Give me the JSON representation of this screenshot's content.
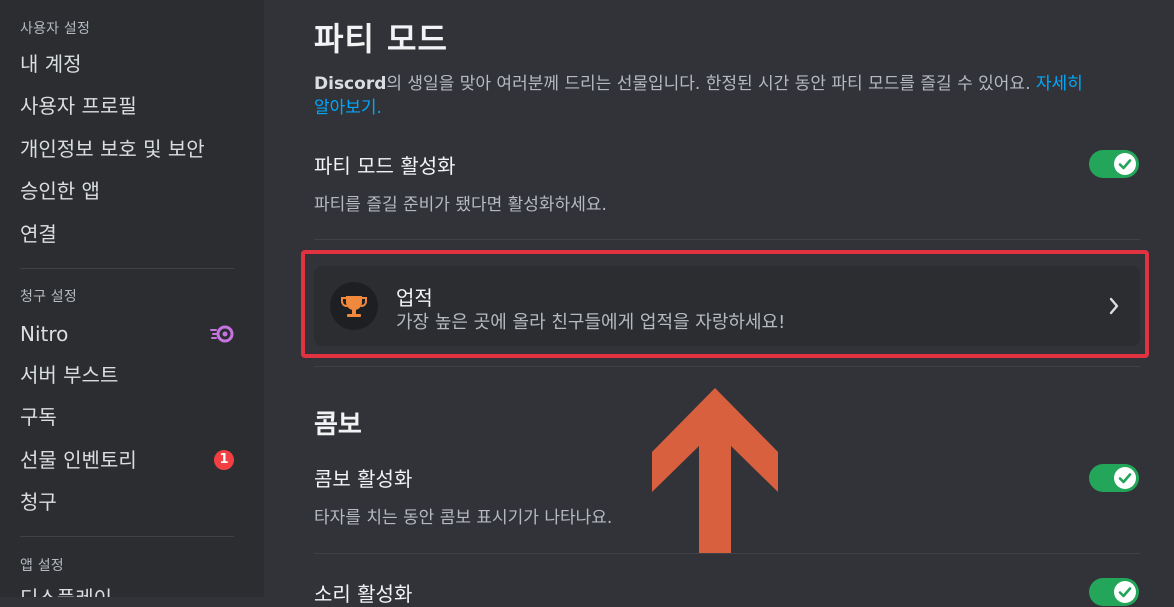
{
  "sidebar": {
    "user_settings_header": "사용자 설정",
    "user_items": [
      "내 계정",
      "사용자 프로필",
      "개인정보 보호 및 보안",
      "승인한 앱",
      "연결"
    ],
    "billing_header": "청구 설정",
    "billing_items": [
      "Nitro",
      "서버 부스트",
      "구독",
      "선물 인벤토리",
      "청구"
    ],
    "gift_badge": "1",
    "app_header": "앱 설정",
    "app_items_partial": "디스플레이"
  },
  "main": {
    "title": "파티 모드",
    "description_brand": "Discord",
    "description_text": "의 생일을 맞아 여러분께 드리는 선물입니다. 한정된 시간 동안 파티 모드를 즐길 수 있어요.",
    "description_link_1": "자세히",
    "description_link_2": "알아보기.",
    "party_mode_toggle_title": "파티 모드 활성화",
    "party_mode_toggle_sub": "파티를 즐길 준비가 됐다면 활성화하세요.",
    "achievement_title": "업적",
    "achievement_sub": "가장 높은 곳에 올라 친구들에게 업적을 자랑하세요!",
    "combo_section": "콤보",
    "combo_toggle_title": "콤보 활성화",
    "combo_toggle_sub": "타자를 치는 동안 콤보 표시기가 나타나요.",
    "sound_toggle_title": "소리 활성화"
  },
  "colors": {
    "toggle_on": "#23a55a",
    "highlight": "#e0333f",
    "arrow": "#d9603e",
    "trophy": "#f0883e",
    "link": "#00a8fc"
  }
}
